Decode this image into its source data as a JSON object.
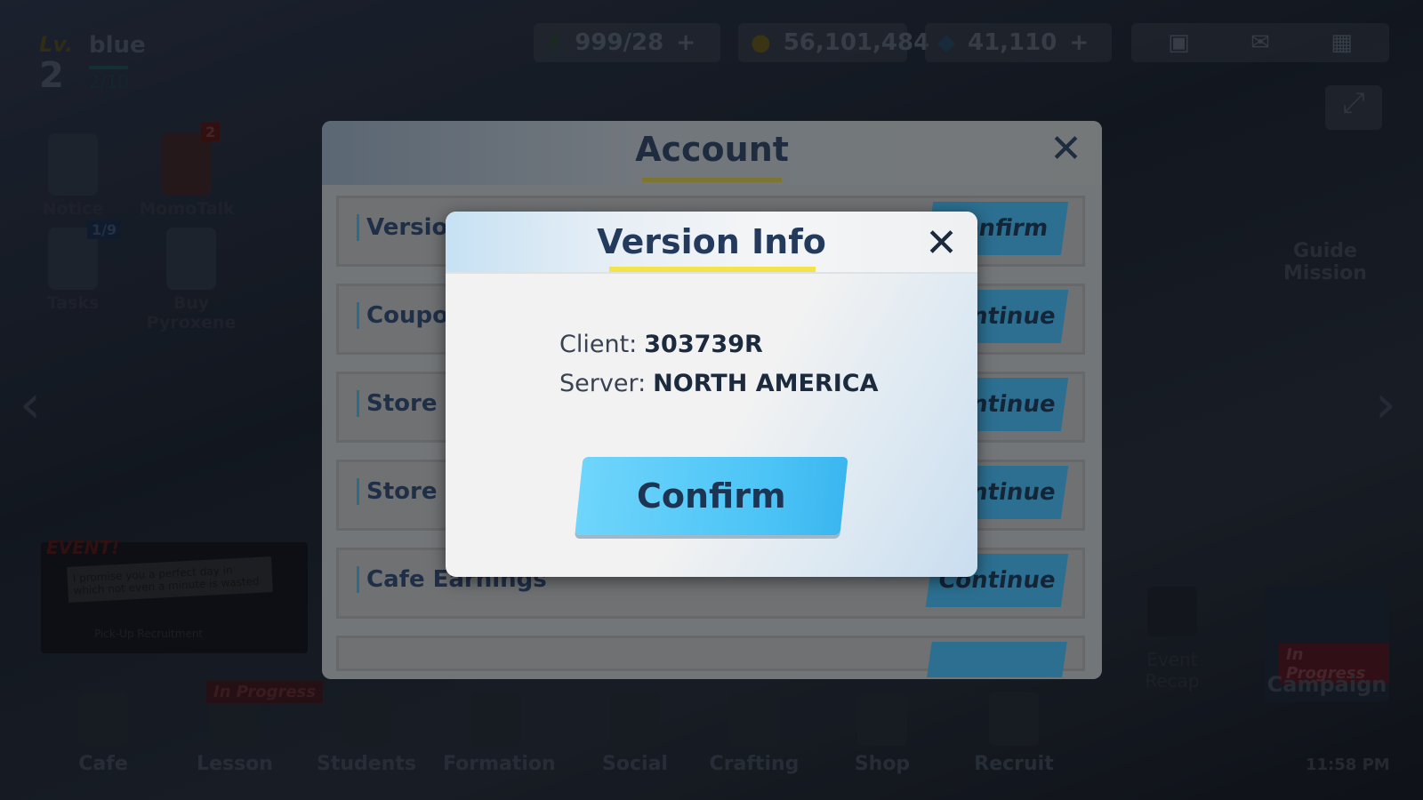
{
  "player": {
    "lv_label": "Lv.",
    "level": "2",
    "name": "blue",
    "exp": "2/10"
  },
  "currencies": {
    "ap": "999/28",
    "credits": "56,101,484",
    "pyroxene": "41,110",
    "plus": "+"
  },
  "side_left": [
    {
      "label": "Notice"
    },
    {
      "label": "MomoTalk",
      "badge": "2"
    },
    {
      "label": "Tasks",
      "badge": "1/9"
    },
    {
      "label": "Buy Pyroxene"
    }
  ],
  "event_banner": {
    "tag": "EVENT!",
    "text": "I promise you a perfect day in which not even a minute is wasted",
    "sub": "Pick-Up Recruitment"
  },
  "side_right": {
    "guide": "Guide Mission",
    "event_recap": "Event Recap",
    "campaign": "Campaign",
    "in_progress": "In Progress"
  },
  "nav": [
    {
      "label": "Cafe"
    },
    {
      "label": "Lesson",
      "badge": "In Progress"
    },
    {
      "label": "Students"
    },
    {
      "label": "Formation"
    },
    {
      "label": "Social"
    },
    {
      "label": "Crafting"
    },
    {
      "label": "Shop"
    },
    {
      "label": "Recruit"
    }
  ],
  "clock": "11:58 PM",
  "account": {
    "title": "Account",
    "rows": [
      {
        "label": "Version",
        "button": "Confirm"
      },
      {
        "label": "Coupon",
        "button": "Continue"
      },
      {
        "label": "Store a",
        "button": "Continue"
      },
      {
        "label": "Store a",
        "button": "Continue"
      },
      {
        "label": "Cafe Earnings",
        "button": "Continue"
      }
    ]
  },
  "version_info": {
    "title": "Version Info",
    "client_label": "Client:",
    "client_value": "303739R",
    "server_label": "Server:",
    "server_value": "NORTH AMERICA",
    "confirm": "Confirm"
  },
  "colors": {
    "accent_blue": "#4cc4f6",
    "underline_yellow": "#f2e44a",
    "title_navy": "#243a5c"
  }
}
